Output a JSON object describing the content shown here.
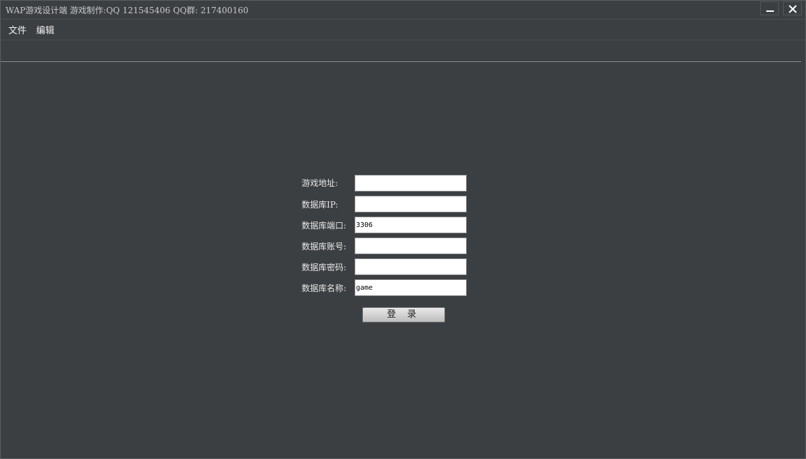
{
  "window": {
    "title": "WAP游戏设计端  游戏制作:QQ 121545406 QQ群: 217400160"
  },
  "menu": {
    "items": [
      {
        "label": "文件"
      },
      {
        "label": "编辑"
      }
    ]
  },
  "form": {
    "fields": [
      {
        "label": "游戏地址:",
        "value": ""
      },
      {
        "label": "数据库IP:",
        "value": ""
      },
      {
        "label": "数据库端口:",
        "value": "3306"
      },
      {
        "label": "数据库账号:",
        "value": ""
      },
      {
        "label": "数据库密码:",
        "value": ""
      },
      {
        "label": "数据库名称:",
        "value": "game"
      }
    ],
    "login_label": "登 录"
  },
  "icons": {
    "minimize": "minimize-icon",
    "close": "close-icon"
  }
}
